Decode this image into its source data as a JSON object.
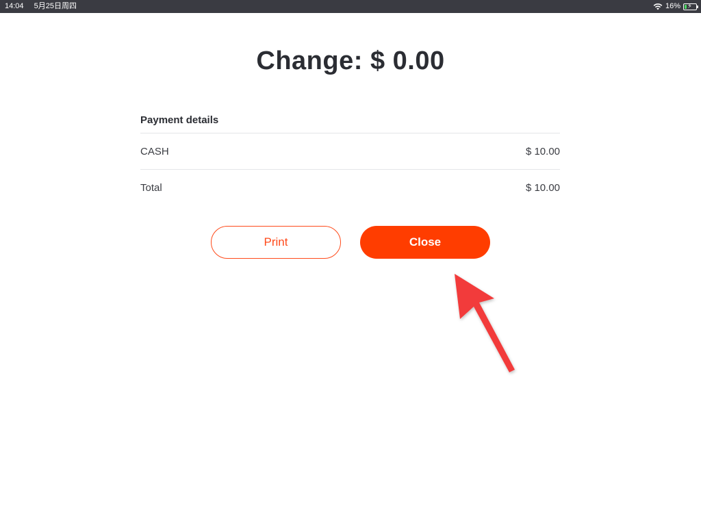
{
  "status_bar": {
    "time": "14:04",
    "date": "5月25日周四",
    "battery_percent": "16%",
    "battery_level": 0.16,
    "icons": [
      "wifi-icon",
      "battery-icon",
      "charging-bolt-icon"
    ]
  },
  "change": {
    "title": "Change: $ 0.00"
  },
  "payment_details": {
    "header": "Payment details",
    "rows": [
      {
        "label": "CASH",
        "amount": "$ 10.00"
      },
      {
        "label": "Total",
        "amount": "$ 10.00"
      }
    ]
  },
  "actions": {
    "print_label": "Print",
    "close_label": "Close"
  },
  "colors": {
    "accent": "#ff3d00",
    "annotation_arrow": "#f23a3a",
    "status_bar_bg": "#3a3b42",
    "battery_fill": "#4cd964"
  },
  "annotation": {
    "icon": "pointer-arrow-icon",
    "points_to": "close-button"
  }
}
